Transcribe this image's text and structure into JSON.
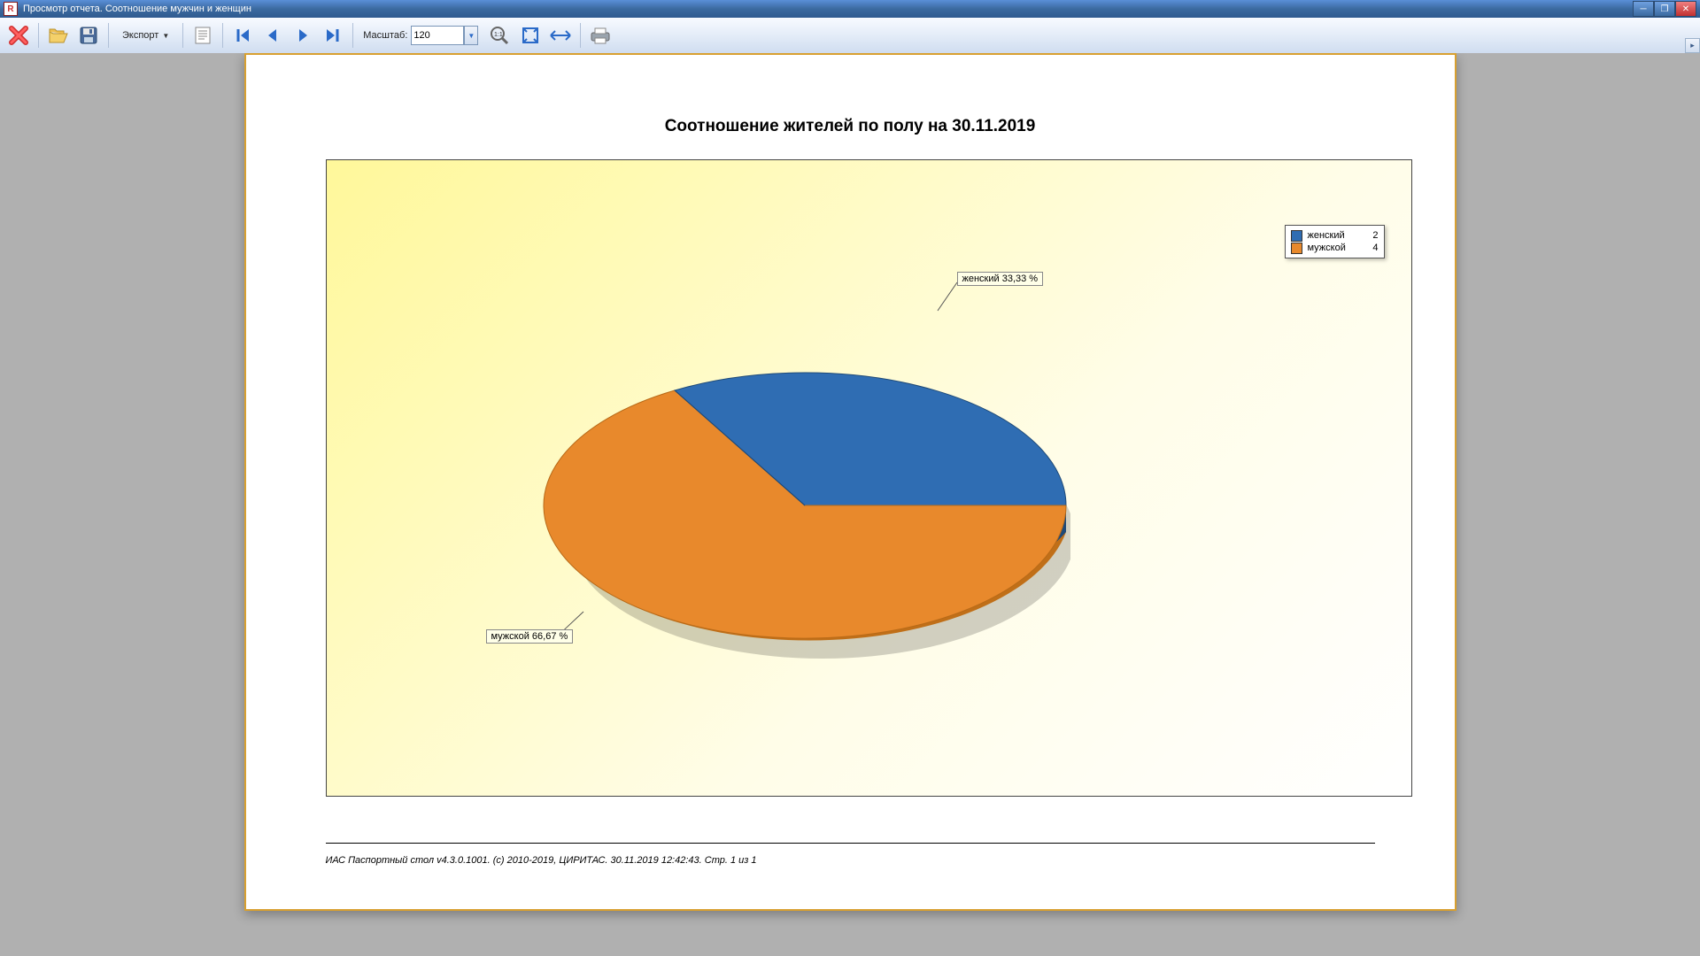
{
  "window": {
    "title": "Просмотр отчета. Соотношение мужчин и женщин"
  },
  "toolbar": {
    "export_label": "Экспорт",
    "zoom_label": "Масштаб:",
    "zoom_value": "120"
  },
  "report": {
    "title": "Соотношение жителей по полу на 30.11.2019",
    "footer": "ИАС Паспортный стол v4.3.0.1001. (c) 2010-2019, ЦИРИТАС. 30.11.2019 12:42:43. Стр. 1 из 1"
  },
  "chart_data": {
    "type": "pie",
    "title": "Соотношение жителей по полу на 30.11.2019",
    "series": [
      {
        "name": "женский",
        "value": 2,
        "percent": 33.33,
        "label": "женский 33,33 %",
        "color": "#2f6db3"
      },
      {
        "name": "мужской",
        "value": 4,
        "percent": 66.67,
        "label": "мужской 66,67 %",
        "color": "#e8892c"
      }
    ],
    "legend_position": "top-right"
  }
}
